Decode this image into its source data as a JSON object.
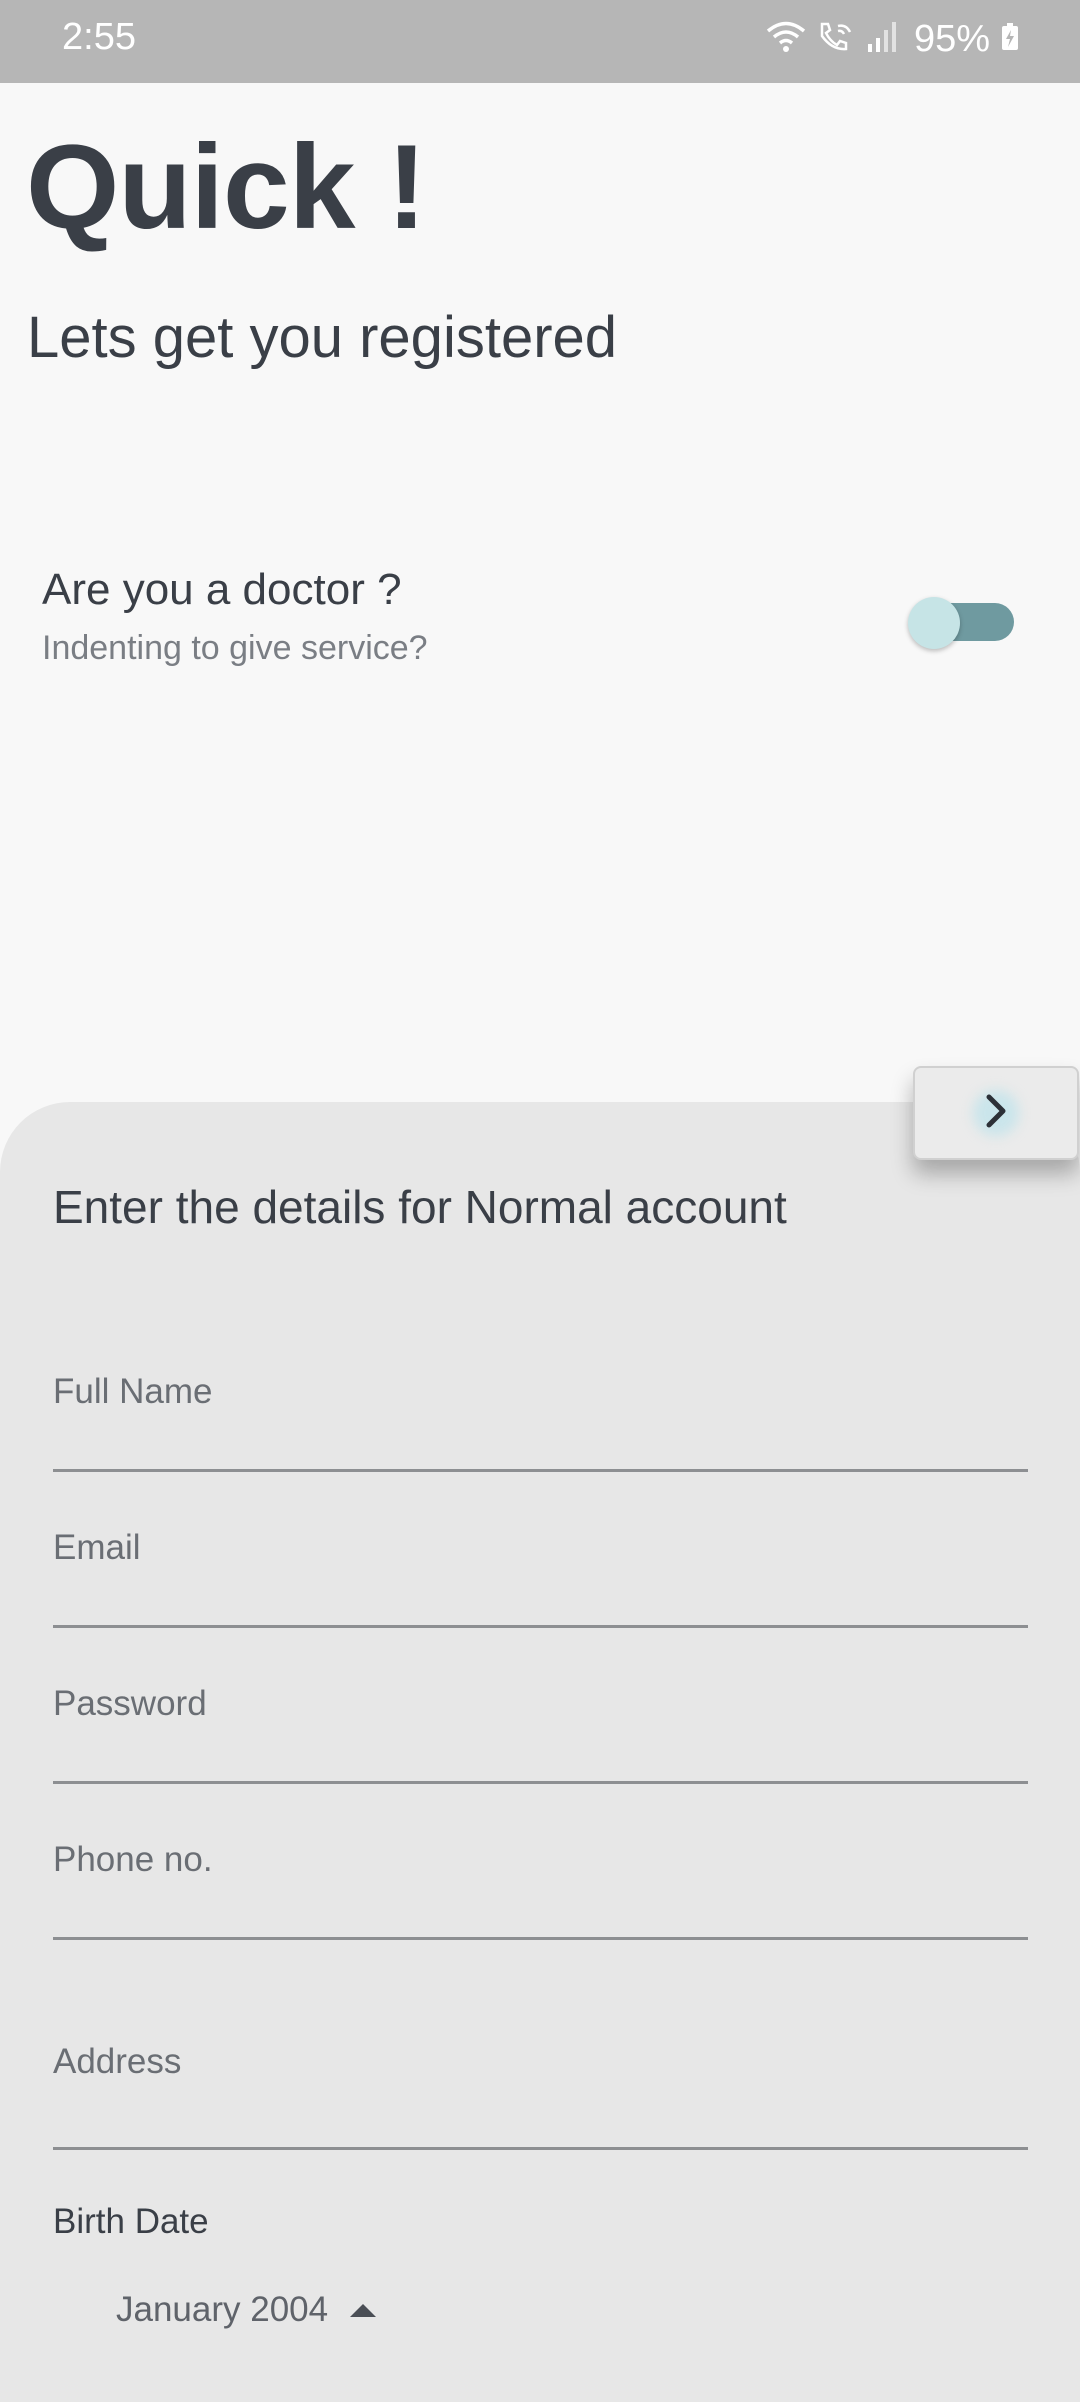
{
  "status_bar": {
    "time": "2:55",
    "battery": "95%",
    "icons": [
      "wifi-icon",
      "wifi-call-icon",
      "signal-icon",
      "battery-charging-icon"
    ]
  },
  "header": {
    "title": "Quick !",
    "subtitle": "Lets get you registered"
  },
  "doctor_toggle": {
    "question": "Are you a doctor ?",
    "hint": "Indenting to give service?",
    "checked": false,
    "track_color": "#6f9aa0",
    "thumb_color": "#c6e4e6"
  },
  "form": {
    "title": "Enter the details for Normal account",
    "next_icon": "chevron-right-icon",
    "fields": {
      "full_name": "Full Name",
      "email": "Email",
      "password": "Password",
      "phone": "Phone no.",
      "address": "Address"
    },
    "birth_date": {
      "label": "Birth Date",
      "month_year": "January 2004"
    }
  },
  "colors": {
    "background": "#f8f8f8",
    "sheet": "#e7e7e7",
    "status_bar": "#b6b6b6",
    "text_dark": "#3a3f47"
  }
}
